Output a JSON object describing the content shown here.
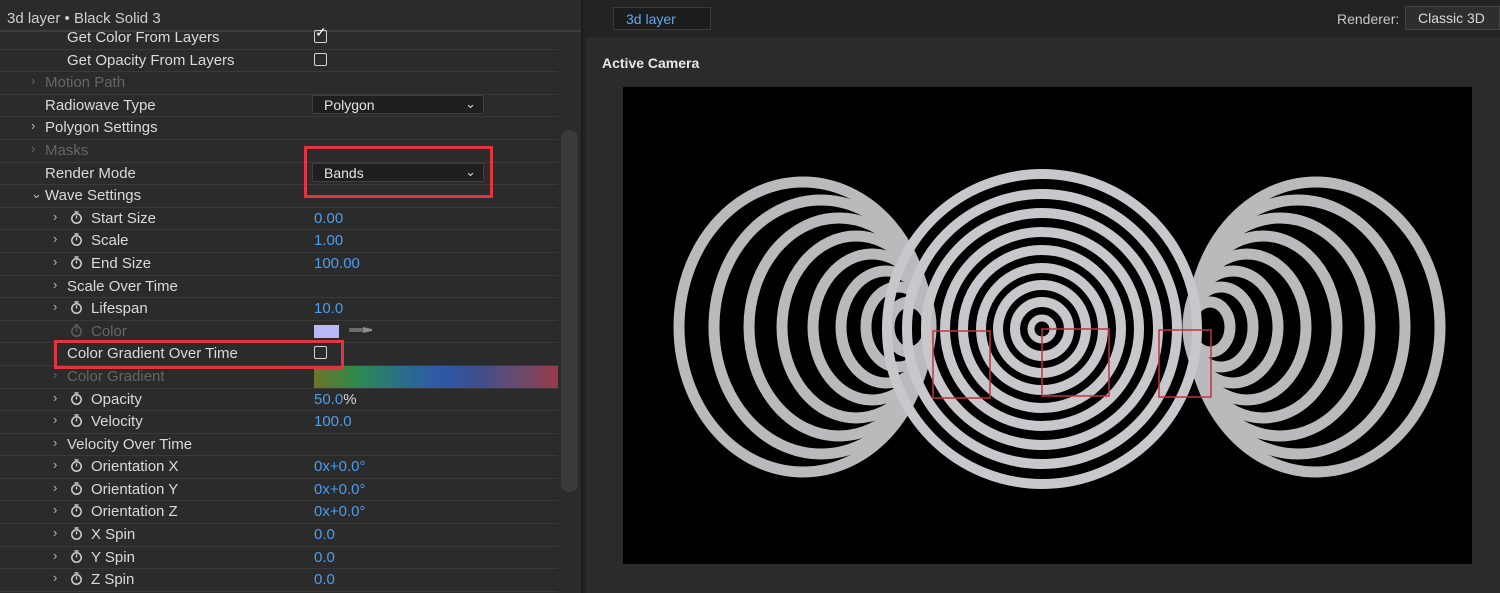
{
  "panel": {
    "title": "3d layer • Black Solid 3"
  },
  "properties": {
    "get_color": "Get Color From Layers",
    "get_opacity": "Get Opacity From Layers",
    "motion_path": "Motion Path",
    "radiowave_type": {
      "label": "Radiowave Type",
      "value": "Polygon"
    },
    "polygon_settings": "Polygon Settings",
    "masks": "Masks",
    "render_mode": {
      "label": "Render Mode",
      "value": "Bands"
    },
    "wave_settings": "Wave Settings",
    "start_size": {
      "label": "Start Size",
      "value": "0.00"
    },
    "scale": {
      "label": "Scale",
      "value": "1.00"
    },
    "end_size": {
      "label": "End Size",
      "value": "100.00"
    },
    "scale_over_time": "Scale Over Time",
    "lifespan": {
      "label": "Lifespan",
      "value": "10.0"
    },
    "color": {
      "label": "Color",
      "swatch": "#b8b8f4"
    },
    "color_gradient_over_time": "Color Gradient Over Time",
    "color_gradient": "Color Gradient",
    "opacity": {
      "label": "Opacity",
      "value": "50.0",
      "unit": "%"
    },
    "velocity": {
      "label": "Velocity",
      "value": "100.0"
    },
    "velocity_over_time": "Velocity Over Time",
    "orientation_x": {
      "label": "Orientation X",
      "value": "0x+0.0°"
    },
    "orientation_y": {
      "label": "Orientation Y",
      "value": "0x+0.0°"
    },
    "orientation_z": {
      "label": "Orientation Z",
      "value": "0x+0.0°"
    },
    "x_spin": {
      "label": "X Spin",
      "value": "0.0"
    },
    "y_spin": {
      "label": "Y Spin",
      "value": "0.0"
    },
    "z_spin": {
      "label": "Z Spin",
      "value": "0.0"
    }
  },
  "checkboxes": {
    "get_color": true,
    "get_opacity": false,
    "color_gradient_over_time": false
  },
  "viewer": {
    "tab_label": "3d layer",
    "renderer_label": "Renderer:",
    "renderer_value": "Classic 3D",
    "viewport_label": "Active Camera"
  },
  "colors": {
    "accent_blue": "#4a9ef0",
    "highlight_red": "#e03642",
    "ring_color": "#c4c4c8"
  }
}
